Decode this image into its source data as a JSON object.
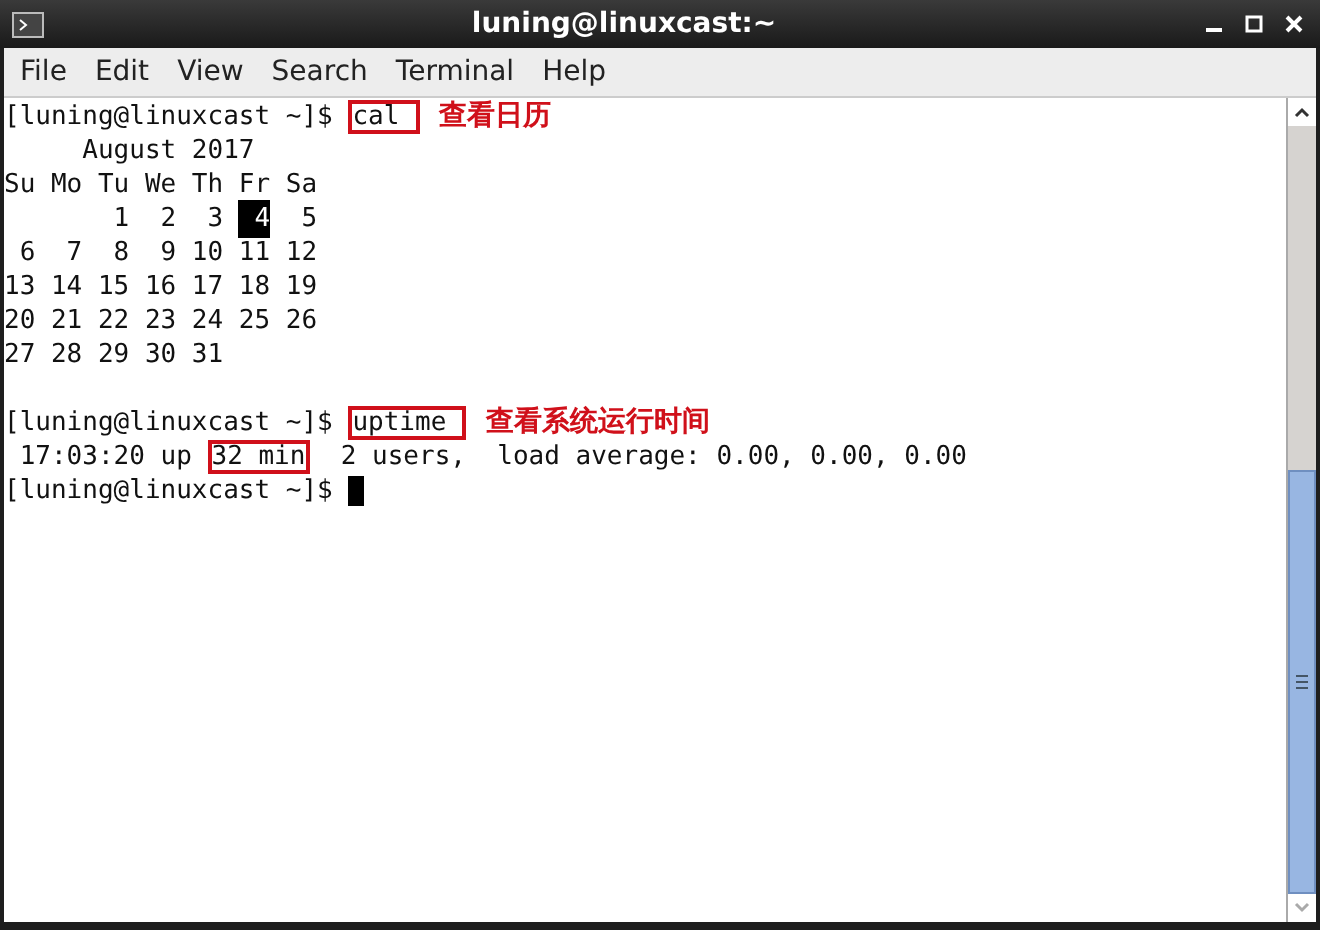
{
  "window": {
    "title": "luning@linuxcast:~"
  },
  "menu": [
    "File",
    "Edit",
    "View",
    "Search",
    "Terminal",
    "Help"
  ],
  "terminal": [
    {
      "kind": "prompt",
      "prompt": "[luning@linuxcast ~]$ ",
      "command": "cal ",
      "boxed": true,
      "note": "查看日历",
      "cursor": false
    },
    {
      "kind": "output",
      "parts": [
        {
          "text": "     August 2017",
          "selected": false,
          "boxed": false
        }
      ]
    },
    {
      "kind": "output",
      "parts": [
        {
          "text": "Su Mo Tu We Th Fr Sa",
          "selected": false,
          "boxed": false
        }
      ]
    },
    {
      "kind": "output",
      "parts": [
        {
          "text": "       1  2  3 ",
          "selected": false,
          "boxed": false
        },
        {
          "text": " 4",
          "selected": true,
          "boxed": false
        },
        {
          "text": "  5",
          "selected": false,
          "boxed": false
        }
      ]
    },
    {
      "kind": "output",
      "parts": [
        {
          "text": " 6  7  8  9 10 11 12",
          "selected": false,
          "boxed": false
        }
      ]
    },
    {
      "kind": "output",
      "parts": [
        {
          "text": "13 14 15 16 17 18 19",
          "selected": false,
          "boxed": false
        }
      ]
    },
    {
      "kind": "output",
      "parts": [
        {
          "text": "20 21 22 23 24 25 26",
          "selected": false,
          "boxed": false
        }
      ]
    },
    {
      "kind": "output",
      "parts": [
        {
          "text": "27 28 29 30 31",
          "selected": false,
          "boxed": false
        }
      ]
    },
    {
      "kind": "blank"
    },
    {
      "kind": "prompt",
      "prompt": "[luning@linuxcast ~]$ ",
      "command": "uptime ",
      "boxed": true,
      "note": "查看系统运行时间",
      "cursor": false
    },
    {
      "kind": "output",
      "parts": [
        {
          "text": " 17:03:20 up ",
          "selected": false,
          "boxed": false
        },
        {
          "text": "32 min",
          "selected": false,
          "boxed": true
        },
        {
          "text": "  2 users,  load average: 0.00, 0.00, 0.00",
          "selected": false,
          "boxed": false
        }
      ]
    },
    {
      "kind": "prompt",
      "prompt": "[luning@linuxcast ~]$ ",
      "cursor": true
    }
  ]
}
